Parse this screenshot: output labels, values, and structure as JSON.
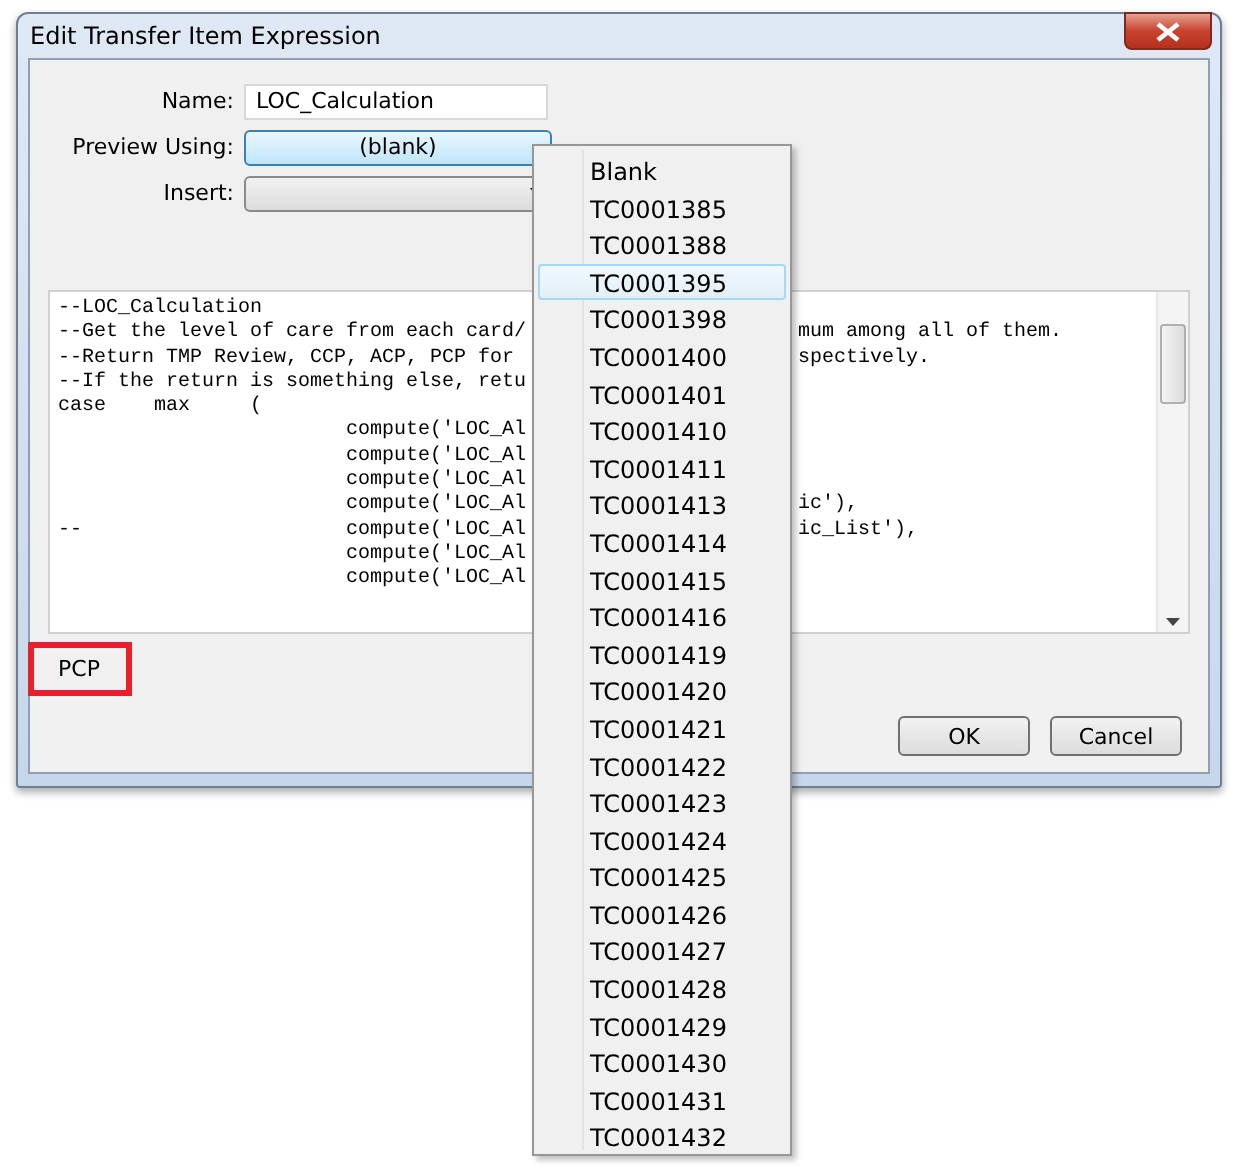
{
  "window": {
    "title": "Edit Transfer Item Expression"
  },
  "name_field": {
    "label": "Name:",
    "value": "LOC_Calculation"
  },
  "preview_using": {
    "label": "Preview Using:",
    "value": "(blank)"
  },
  "insert": {
    "label": "Insert:"
  },
  "code_lines": [
    {
      "left": "--LOC_Calculation"
    },
    {
      "left": "--Get the level of care from each card/",
      "right": "mum among all of them."
    },
    {
      "left": "--Return TMP Review, CCP, ACP, PCP for",
      "right": "spectively."
    },
    {
      "left": "--If the return is something else, retu"
    },
    {
      "left": "case    max     ("
    },
    {
      "left": "                        compute('LOC_Al"
    },
    {
      "left": "                        compute('LOC_Al"
    },
    {
      "left": "                        compute('LOC_Al"
    },
    {
      "left": "                        compute('LOC_Al",
      "right": "ic'),"
    },
    {
      "left": "--                      compute('LOC_Al",
      "right": "ic_List'),"
    },
    {
      "left": "                        compute('LOC_Al"
    },
    {
      "left": "                        compute('LOC_Al"
    }
  ],
  "result": {
    "text": "PCP",
    "highlighted": true
  },
  "buttons": [
    {
      "label": "OK"
    },
    {
      "label": "Cancel"
    }
  ],
  "dropdown": [
    {
      "label": "Blank",
      "selected": false
    },
    {
      "label": "TC0001385",
      "selected": false
    },
    {
      "label": "TC0001388",
      "selected": false
    },
    {
      "label": "TC0001395",
      "selected": true
    },
    {
      "label": "TC0001398",
      "selected": false
    },
    {
      "label": "TC0001400",
      "selected": false
    },
    {
      "label": "TC0001401",
      "selected": false
    },
    {
      "label": "TC0001410",
      "selected": false
    },
    {
      "label": "TC0001411",
      "selected": false
    },
    {
      "label": "TC0001413",
      "selected": false
    },
    {
      "label": "TC0001414",
      "selected": false
    },
    {
      "label": "TC0001415",
      "selected": false
    },
    {
      "label": "TC0001416",
      "selected": false
    },
    {
      "label": "TC0001419",
      "selected": false
    },
    {
      "label": "TC0001420",
      "selected": false
    },
    {
      "label": "TC0001421",
      "selected": false
    },
    {
      "label": "TC0001422",
      "selected": false
    },
    {
      "label": "TC0001423",
      "selected": false
    },
    {
      "label": "TC0001424",
      "selected": false
    },
    {
      "label": "TC0001425",
      "selected": false
    },
    {
      "label": "TC0001426",
      "selected": false
    },
    {
      "label": "TC0001427",
      "selected": false
    },
    {
      "label": "TC0001428",
      "selected": false
    },
    {
      "label": "TC0001429",
      "selected": false
    },
    {
      "label": "TC0001430",
      "selected": false
    },
    {
      "label": "TC0001431",
      "selected": false
    },
    {
      "label": "TC0001432",
      "selected": false
    }
  ]
}
